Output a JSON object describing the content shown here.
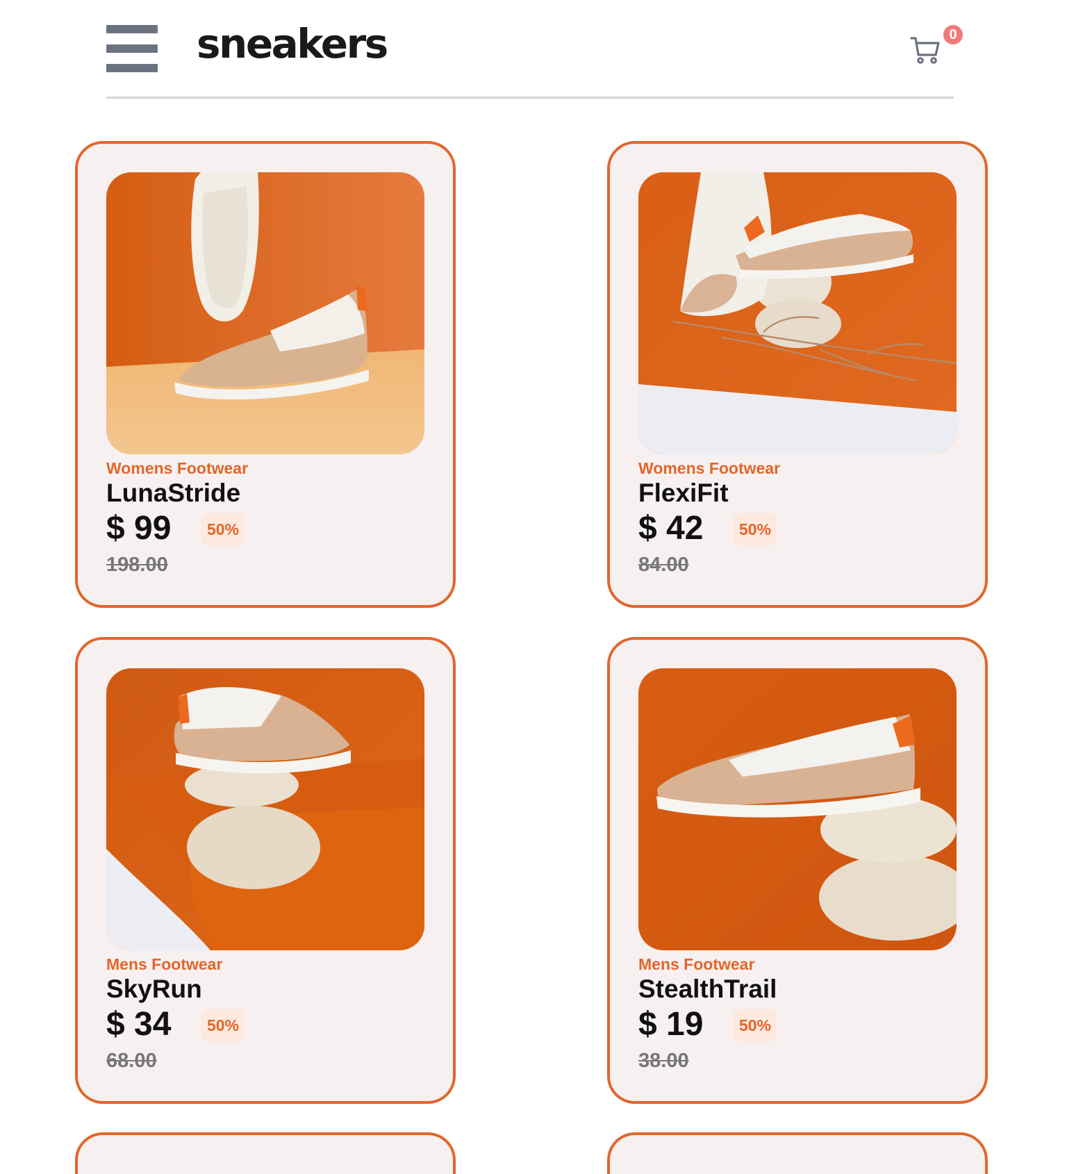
{
  "header": {
    "logo": "sneakers",
    "cart_count": "0"
  },
  "colors": {
    "accent": "#e0672b",
    "card_bg": "#f7f0f0",
    "badge": "#f27a7a",
    "discount_bg": "#fde9dd"
  },
  "products": [
    {
      "category": "Womens Footwear",
      "name": "LunaStride",
      "price": "$ 99",
      "discount": "50%",
      "original_price": "198.00"
    },
    {
      "category": "Womens Footwear",
      "name": "FlexiFit",
      "price": "$ 42",
      "discount": "50%",
      "original_price": "84.00"
    },
    {
      "category": "Mens Footwear",
      "name": "SkyRun",
      "price": "$ 34",
      "discount": "50%",
      "original_price": "68.00"
    },
    {
      "category": "Mens Footwear",
      "name": "StealthTrail",
      "price": "$ 19",
      "discount": "50%",
      "original_price": "38.00"
    }
  ]
}
